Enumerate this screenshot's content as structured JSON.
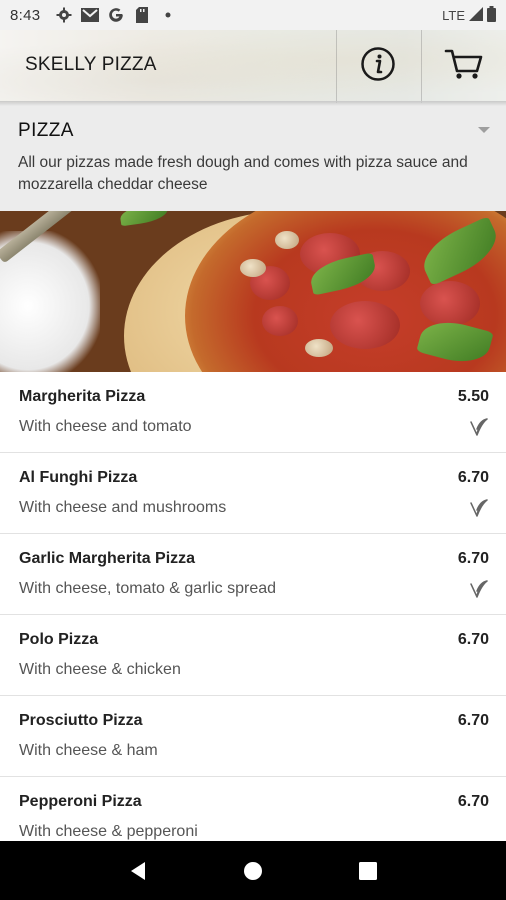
{
  "status_bar": {
    "time": "8:43",
    "network": "LTE",
    "icons": [
      "settings-icon",
      "gmail-icon",
      "google-icon",
      "sd-card-icon",
      "notification-dot-icon",
      "signal-icon",
      "battery-icon"
    ]
  },
  "app_bar": {
    "title": "SKELLY PIZZA",
    "actions": [
      "info-icon",
      "cart-icon"
    ]
  },
  "category": {
    "title": "PIZZA",
    "description": "All our pizzas made fresh dough and comes with pizza sauce and mozzarella cheddar cheese"
  },
  "menu_items": [
    {
      "name": "Margherita Pizza",
      "description": "With cheese and tomato",
      "price": "5.50",
      "vegetarian": true
    },
    {
      "name": "Al Funghi Pizza",
      "description": "With cheese and mushrooms",
      "price": "6.70",
      "vegetarian": true
    },
    {
      "name": "Garlic Margherita Pizza",
      "description": "With cheese, tomato & garlic spread",
      "price": "6.70",
      "vegetarian": true
    },
    {
      "name": "Polo Pizza",
      "description": "With cheese & chicken",
      "price": "6.70",
      "vegetarian": false
    },
    {
      "name": "Prosciutto Pizza",
      "description": "With cheese & ham",
      "price": "6.70",
      "vegetarian": false
    },
    {
      "name": "Pepperoni Pizza",
      "description": "With cheese & pepperoni",
      "price": "6.70",
      "vegetarian": false
    }
  ],
  "nav_bar": {
    "buttons": [
      "back-icon",
      "home-icon",
      "recents-icon"
    ]
  },
  "colors": {
    "category_bg": "#ececec",
    "status_bar_bg": "#f2f2f2",
    "nav_bar_bg": "#000000"
  }
}
